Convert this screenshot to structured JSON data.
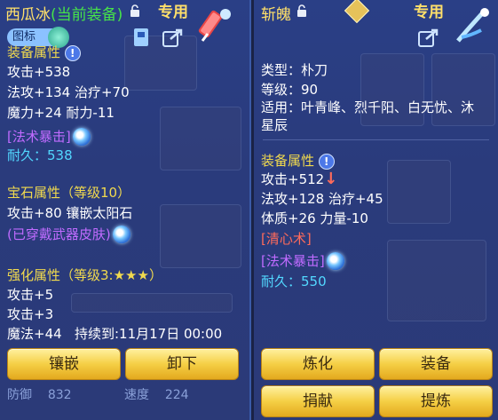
{
  "left": {
    "title": "西瓜冰",
    "title_status": "(当前装备)",
    "tag": "专用",
    "label_btn": "图标",
    "section_equip": "装备属性",
    "attrs": [
      "攻击+538",
      "法攻+134 治疗+70",
      "魔力+24 耐力-11"
    ],
    "skill": "[法术暴击]",
    "durability": "耐久：538",
    "gem_header": "宝石属性（等级10）",
    "gem_line": "攻击+80 镶嵌太阳石",
    "skin": "(已穿戴武器皮肤)",
    "enhance_header": "强化属性（等级3:★★★）",
    "enhance": [
      "攻击+5",
      "攻击+3"
    ],
    "magic": "魔法+44",
    "duration": "持续到:11月17日 00:00",
    "btn_inlay": "镶嵌",
    "btn_unequip": "卸下",
    "bottom_left": "防御",
    "bottom_left_val": "832",
    "bottom_right": "速度",
    "bottom_right_val": "224"
  },
  "right": {
    "title": "斩魄",
    "tag": "专用",
    "type": "类型：朴刀",
    "level": "等级：90",
    "fits": "适用：叶青峰、烈千阳、白无忧、沐",
    "fits2": "星辰",
    "section_equip": "装备属性",
    "attack": "攻击+512",
    "attrs": [
      "法攻+128 治疗+45",
      "体质+26 力量-10"
    ],
    "skill1": "[清心术]",
    "skill2": "[法术暴击]",
    "durability": "耐久：550",
    "btn_refine": "炼化",
    "btn_equip": "装备",
    "btn_donate": "捐献",
    "btn_extract": "提炼"
  },
  "colors": {
    "gold": "#ffe06a",
    "green": "#46e34a",
    "yellow": "#f1da4e",
    "purple": "#c06bff",
    "cyan": "#52d8ff",
    "red": "#ff6b5b"
  }
}
